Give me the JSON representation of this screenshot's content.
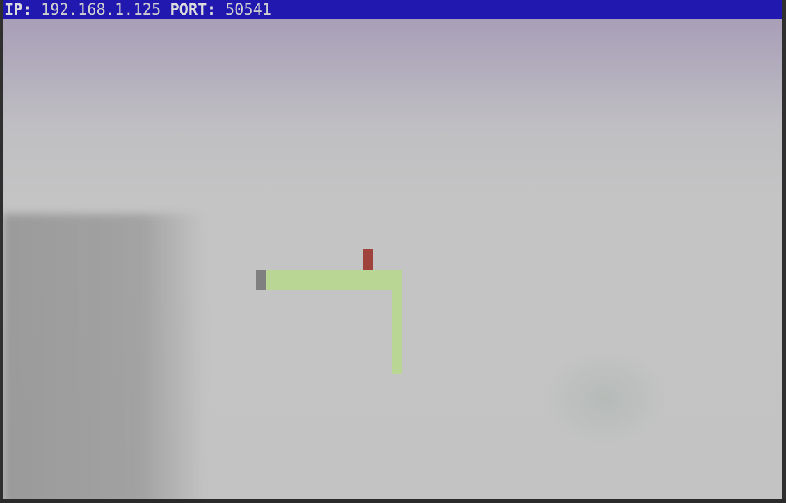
{
  "statusbar": {
    "ip_label": "IP:",
    "ip_value": "192.168.1.125",
    "port_label": "PORT:",
    "port_value": "50541"
  },
  "game": {
    "snake_color": "#bad694",
    "tail_color": "#808080",
    "food_color": "#a0423c",
    "background_color": "#c4c4c4"
  },
  "colors": {
    "statusbar_bg": "#2118b0",
    "statusbar_text": "#d8d8d8"
  }
}
